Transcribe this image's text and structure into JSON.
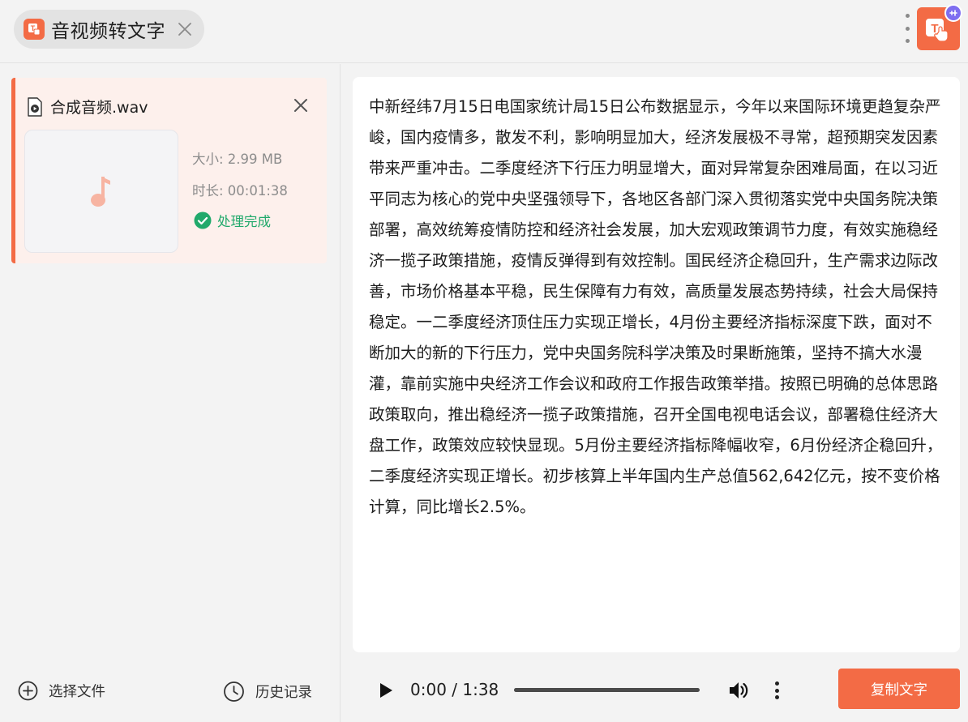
{
  "tab": {
    "title": "音视频转文字"
  },
  "colors": {
    "accent": "#f36b45",
    "success": "#21a96b",
    "badge": "#7e6ef0"
  },
  "icons": {
    "tab": "app-t-icon",
    "tab_close": "close-icon",
    "menu": "kebab-menu-icon",
    "app_logo": "app-logo-icon",
    "file_type": "video-file-icon",
    "thumb": "music-note-icon",
    "status": "check-circle-icon",
    "choose": "plus-circle-icon",
    "history": "clock-icon",
    "play": "play-icon",
    "volume": "volume-icon"
  },
  "file": {
    "name": "合成音频.wav",
    "size": "大小: 2.99 MB",
    "duration": "时长: 00:01:38",
    "status": "处理完成"
  },
  "sidebar": {
    "choose_file": "选择文件",
    "history": "历史记录"
  },
  "transcript": {
    "text": "中新经纬7月15日电国家统计局15日公布数据显示，今年以来国际环境更趋复杂严峻，国内疫情多，散发不利，影响明显加大，经济发展极不寻常，超预期突发因素带来严重冲击。二季度经济下行压力明显增大，面对异常复杂困难局面，在以习近平同志为核心的党中央坚强领导下，各地区各部门深入贯彻落实党中央国务院决策部署，高效统筹疫情防控和经济社会发展，加大宏观政策调节力度，有效实施稳经济一揽子政策措施，疫情反弹得到有效控制。国民经济企稳回升，生产需求边际改善，市场价格基本平稳，民生保障有力有效，高质量发展态势持续，社会大局保持稳定。一二季度经济顶住压力实现正增长，4月份主要经济指标深度下跌，面对不断加大的新的下行压力，党中央国务院科学决策及时果断施策，坚持不搞大水漫灌，靠前实施中央经济工作会议和政府工作报告政策举措。按照已明确的总体思路政策取向，推出稳经济一揽子政策措施，召开全国电视电话会议，部署稳住经济大盘工作，政策效应较快显现。5月份主要经济指标降幅收窄，6月份经济企稳回升，二季度经济实现正增长。初步核算上半年国内生产总值562,642亿元，按不变价格计算，同比增长2.5%。"
  },
  "player": {
    "time": "0:00 / 1:38",
    "progress": 1.0
  },
  "actions": {
    "copy": "复制文字"
  }
}
